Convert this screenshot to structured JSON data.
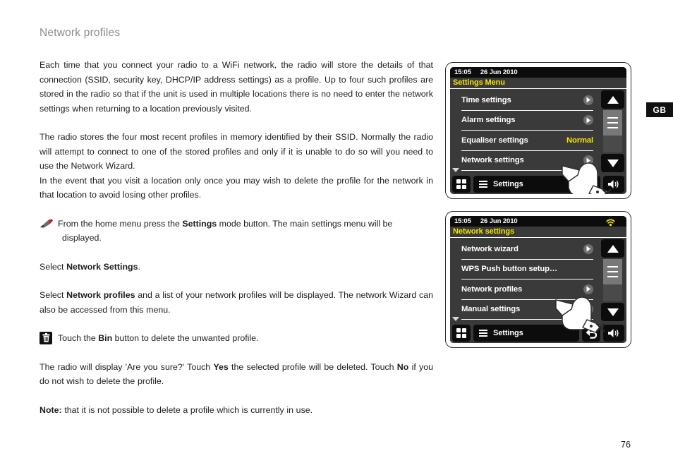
{
  "document": {
    "title": "Network profiles",
    "language_badge": "GB",
    "page_number": "76",
    "paragraphs": [
      "Each time that you connect your radio to a WiFi network, the radio will store the details of that connection (SSID, security key, DHCP/IP address settings) as a profile. Up to four such profiles are stored in the radio so that if the unit is used in multiple locations there is no need to enter the network settings when returning to a location previously visited.",
      "The radio stores the four most recent profiles in memory identified by their SSID. Normally the radio will attempt to connect to one of the stored profiles and only if it is unable to do so will you need to use the Network Wizard.",
      "In the event that you visit a location only once you may wish to delete the profile for the network in that location to avoid losing other profiles."
    ],
    "steps": [
      {
        "icon": "stylus-pen-icon",
        "line1_a": "From the home menu press the ",
        "line1_bold": "Settings",
        "line1_b": " mode button. The main settings menu will be",
        "line2": "displayed."
      }
    ],
    "select_network_settings": {
      "prefix": "Select ",
      "bold": "Network Settings",
      "suffix": "."
    },
    "select_network_profiles": {
      "prefix": "Select ",
      "bold": "Network profiles",
      "suffix": " and a list of your network profiles will be displayed. The network Wizard can also be accessed from this menu."
    },
    "bin_step": {
      "icon": "bin-icon",
      "prefix": "Touch the ",
      "bold": "Bin",
      "suffix": " button to delete the unwanted profile."
    },
    "confirm_paragraph": {
      "part1": "The radio will display 'Are you sure?' Touch ",
      "bold1": "Yes",
      "part2": " the selected profile will be deleted. Touch ",
      "bold2": "No",
      "part3": " if you do not wish to delete the profile."
    },
    "note": {
      "bold": "Note:",
      "text": " that it is not possible to delete a profile which is currently in use."
    }
  },
  "colors": {
    "screen_bg": "#3a3a3a",
    "status_bg": "#0c0c0c",
    "accent_yellow": "#f5e500",
    "text_white": "#ffffff",
    "title_grey": "#8c8c8c"
  },
  "devices": [
    {
      "id": "settings-menu-screen",
      "status": {
        "time": "15:05",
        "date": "26 Jun 2010",
        "wifi_icon": false
      },
      "menu_title": "Settings Menu",
      "rows": [
        {
          "label": "Time settings",
          "value": "",
          "chevron": true
        },
        {
          "label": "Alarm settings",
          "value": "",
          "chevron": true
        },
        {
          "label": "Equaliser settings",
          "value": "Normal",
          "chevron": false
        },
        {
          "label": "Network settings",
          "value": "",
          "chevron": true
        }
      ],
      "scroll": {
        "up_icon": "triangle-up-icon",
        "down_icon": "triangle-down-icon",
        "thumb_lines": 3
      },
      "toolbar": {
        "grid_icon": "grid-menu-icon",
        "mode_icon": "hamburger-icon",
        "mode_label": "Settings",
        "back_icon": "",
        "volume_icon": "speaker-icon",
        "show_back": false
      },
      "hand_cursor": true
    },
    {
      "id": "network-settings-screen",
      "status": {
        "time": "15:05",
        "date": "26 Jun 2010",
        "wifi_icon": true
      },
      "menu_title": "Network settings",
      "rows": [
        {
          "label": "Network wizard",
          "value": "",
          "chevron": true
        },
        {
          "label": "WPS Push button setup…",
          "value": "",
          "chevron": false
        },
        {
          "label": "Network profiles",
          "value": "",
          "chevron": true
        },
        {
          "label": "Manual settings",
          "value": "",
          "chevron": true
        }
      ],
      "scroll": {
        "up_icon": "triangle-up-icon",
        "down_icon": "triangle-down-icon",
        "thumb_lines": 3
      },
      "toolbar": {
        "grid_icon": "grid-menu-icon",
        "mode_icon": "hamburger-icon",
        "mode_label": "Settings",
        "back_icon": "back-arrow-icon",
        "volume_icon": "speaker-icon",
        "show_back": true
      },
      "hand_cursor": true
    }
  ]
}
